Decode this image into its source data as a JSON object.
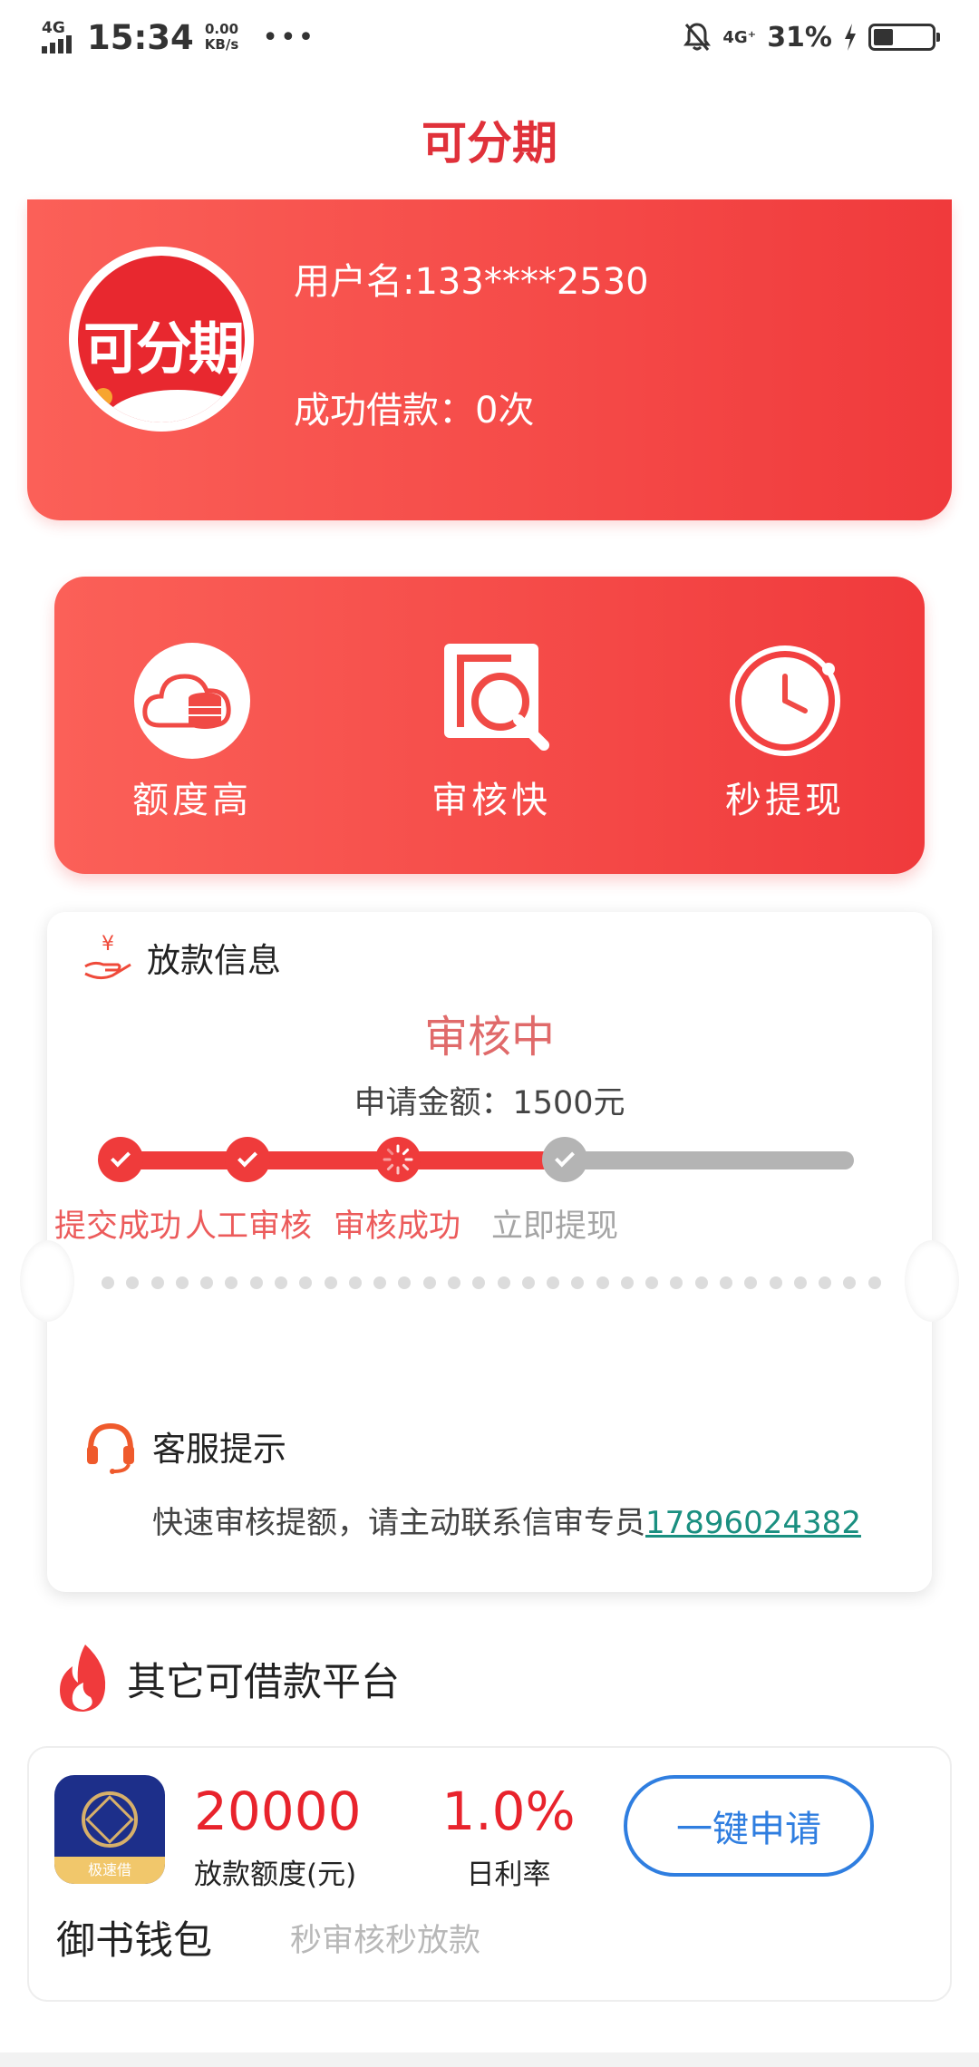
{
  "status_bar": {
    "network": "4G",
    "time": "15:34",
    "speed_value": "0.00",
    "speed_unit": "KB/s",
    "network_right": "4G⁺",
    "battery_pct": "31%",
    "battery_level": 0.31
  },
  "header": {
    "title": "可分期"
  },
  "profile": {
    "avatar_text": "可分期",
    "username": "用户名:133****2530",
    "loan_count": "成功借款：0次"
  },
  "features": [
    {
      "label": "额度高",
      "icon": "cloud-coins-icon"
    },
    {
      "label": "审核快",
      "icon": "magnify-document-icon"
    },
    {
      "label": "秒提现",
      "icon": "clock-icon"
    }
  ],
  "loan_info": {
    "heading": "放款信息",
    "status": "审核中",
    "apply_amount": "申请金额：1500元",
    "progress_fraction": 0.63,
    "steps": [
      {
        "label": "提交成功",
        "state": "done"
      },
      {
        "label": "人工审核",
        "state": "done"
      },
      {
        "label": "审核成功",
        "state": "loading"
      },
      {
        "label": "立即提现",
        "state": "pending"
      }
    ],
    "service_heading": "客服提示",
    "service_message": "快速审核提额，请主动联系信审专员",
    "service_phone": "17896024382"
  },
  "other_platforms": {
    "heading": "其它可借款平台",
    "items": [
      {
        "logo_text": "极速借",
        "amount": "20000",
        "amount_label": "放款额度(元)",
        "rate": "1.0%",
        "rate_label": "日利率",
        "apply_label": "一键申请",
        "name": "御书钱包",
        "description": "秒审核秒放款"
      }
    ]
  },
  "colors": {
    "brand_red": "#ef3b3b",
    "title_red": "#e0313a",
    "link_teal": "#1a8f80",
    "button_blue": "#2f7ee0",
    "pending_grey": "#b4b4b4"
  }
}
